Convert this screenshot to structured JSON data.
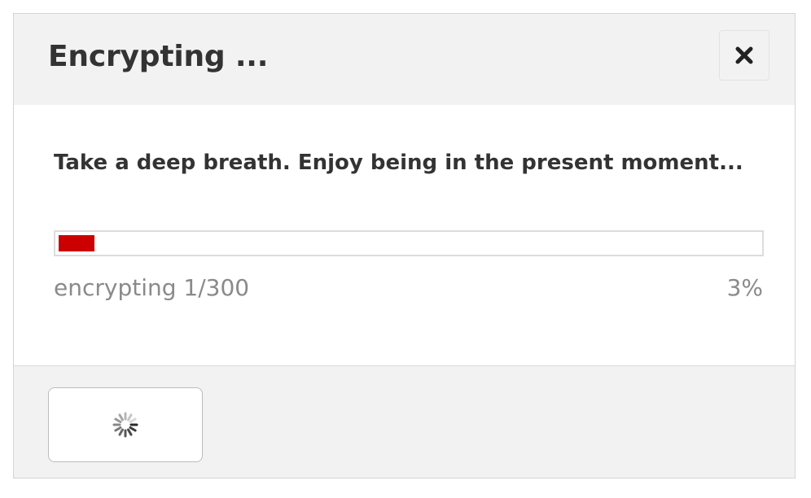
{
  "dialog": {
    "title": "Encrypting ...",
    "close_icon": "close-icon",
    "message": "Take a deep breath. Enjoy being in the present moment...",
    "progress": {
      "fraction": 0.03,
      "label": "encrypting 1/300",
      "percent_text": "3%",
      "fill_color": "#cc0000"
    },
    "footer": {
      "button_icon": "spinner-icon"
    }
  }
}
